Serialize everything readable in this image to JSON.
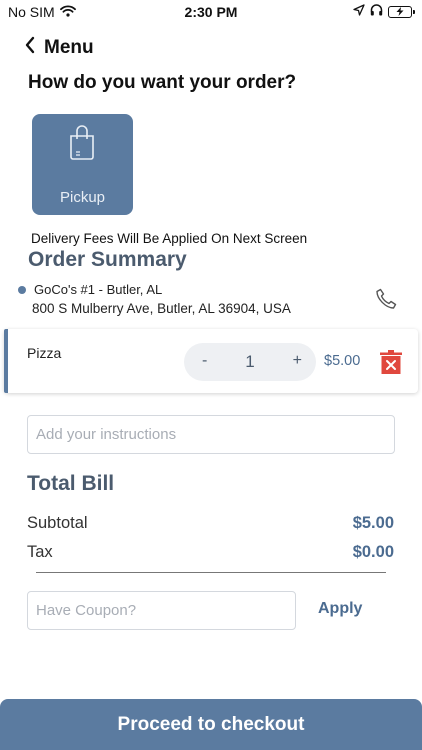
{
  "status_bar": {
    "carrier": "No SIM",
    "time": "2:30 PM"
  },
  "nav": {
    "back_label": "Menu"
  },
  "order_type": {
    "question": "How do you want your order?",
    "option_pickup_label": "Pickup"
  },
  "delivery_note": "Delivery Fees Will Be Applied On Next Screen",
  "order_summary": {
    "title": "Order Summary",
    "store_name": "GoCo's #1 - Butler, AL",
    "store_address": "800 S Mulberry Ave, Butler, AL 36904, USA"
  },
  "items": [
    {
      "name": "Pizza",
      "minus_label": "-",
      "quantity": "1",
      "plus_label": "+",
      "price": "$5.00"
    }
  ],
  "instructions": {
    "placeholder": "Add your instructions",
    "value": ""
  },
  "bill": {
    "title": "Total Bill",
    "subtotal_label": "Subtotal",
    "subtotal_value": "$5.00",
    "tax_label": "Tax",
    "tax_value": "$0.00"
  },
  "coupon": {
    "placeholder": "Have Coupon?",
    "value": "",
    "apply_label": "Apply"
  },
  "checkout_label": "Proceed to checkout",
  "colors": {
    "accent": "#5b7ba0",
    "heading": "#4b5b6e",
    "delete": "#e0483e"
  },
  "icons": {
    "back": "chevron-left-icon",
    "pickup": "shopping-bag-icon",
    "phone": "phone-icon",
    "delete": "trash-icon"
  }
}
